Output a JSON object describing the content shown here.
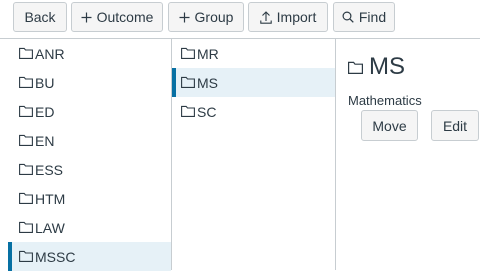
{
  "toolbar": {
    "back_label": "Back",
    "outcome_label": "Outcome",
    "group_label": "Group",
    "import_label": "Import",
    "find_label": "Find"
  },
  "column1": {
    "items": [
      {
        "label": "ANR"
      },
      {
        "label": "BU"
      },
      {
        "label": "ED"
      },
      {
        "label": "EN"
      },
      {
        "label": "ESS"
      },
      {
        "label": "HTM"
      },
      {
        "label": "LAW"
      },
      {
        "label": "MSSC"
      }
    ],
    "selected_index": 7
  },
  "column2": {
    "items": [
      {
        "label": "MR"
      },
      {
        "label": "MS"
      },
      {
        "label": "SC"
      }
    ],
    "selected_index": 1
  },
  "detail": {
    "title": "MS",
    "description": "Mathematics",
    "move_label": "Move",
    "edit_label": "Edit"
  },
  "colors": {
    "selected_bg": "#e6f1f7",
    "selected_accent": "#0770a3",
    "border": "#c7cdd1",
    "button_bg": "#f5f5f5"
  }
}
